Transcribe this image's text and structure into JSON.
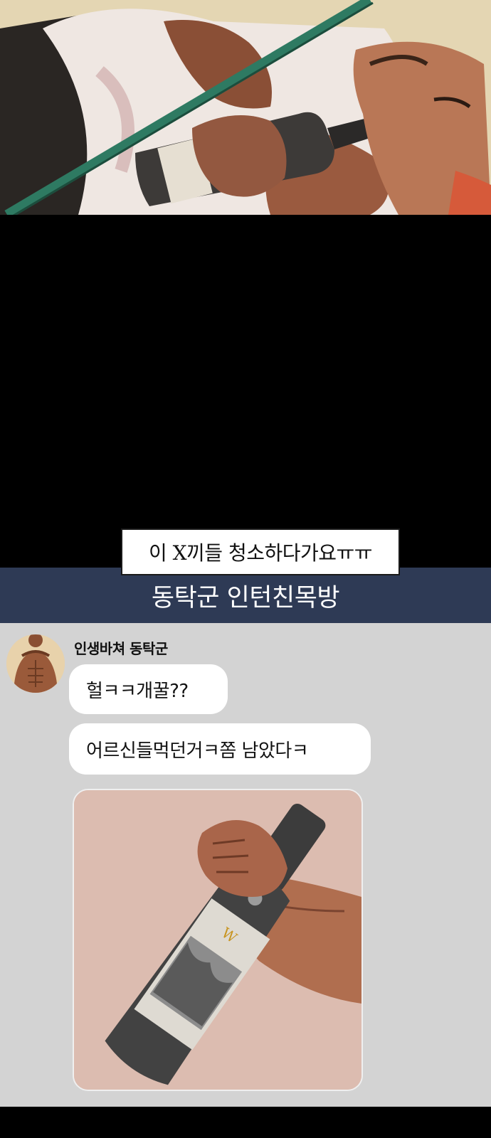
{
  "caption": {
    "text": "이 X끼들 청소하다가요ㅠㅠ"
  },
  "chat": {
    "room_title": "동탁군 인턴친목방",
    "sender": {
      "name": "인생바쳐 동탁군",
      "avatar_icon": "shirtless-man-avatar-icon"
    },
    "messages": [
      {
        "text": "헐ㅋㅋ개꿀??"
      },
      {
        "text": "어르신들먹던거ㅋ쫌 남았다ㅋ"
      }
    ],
    "photo": {
      "icon": "hand-holding-bottle-icon"
    }
  },
  "colors": {
    "header_bg": "#2e3a55",
    "chat_bg": "#d3d3d3",
    "bubble_bg": "#ffffff",
    "background": "#000000"
  }
}
